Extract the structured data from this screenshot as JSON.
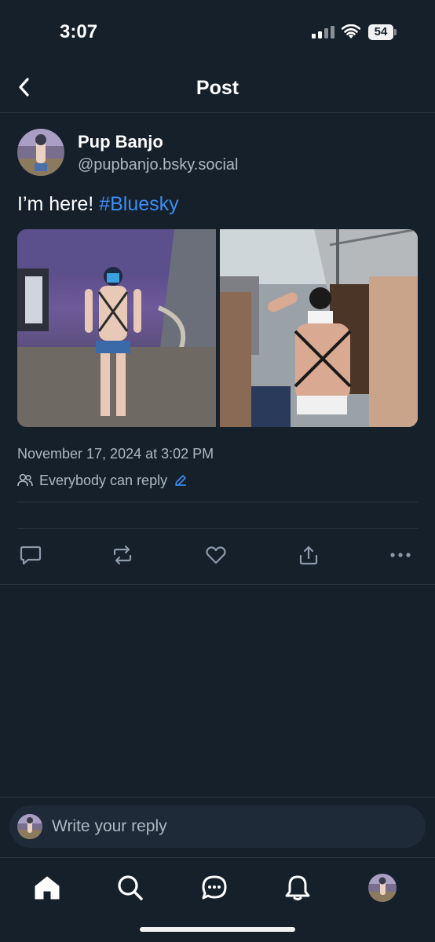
{
  "status_bar": {
    "time": "3:07",
    "battery": "54"
  },
  "header": {
    "title": "Post",
    "back_icon": "chevron-left-icon"
  },
  "post": {
    "author": {
      "name": "Pup Banjo",
      "handle": "@pupbanjo.bsky.social"
    },
    "text": "I’m here! ",
    "hashtag": "#Bluesky",
    "images": [
      "pup-harness-cruise-atrium-photo",
      "pup-salute-cruise-deck-photo"
    ],
    "timestamp": "November 17, 2024 at 3:02 PM",
    "reply_permission": "Everybody can reply",
    "actions": [
      "reply-icon",
      "repost-icon",
      "like-icon",
      "share-icon",
      "more-icon"
    ]
  },
  "reply_bar": {
    "placeholder": "Write your reply"
  },
  "bottom_nav": {
    "items": [
      "home-icon",
      "search-icon",
      "chat-icon",
      "notifications-icon",
      "profile-avatar"
    ]
  },
  "colors": {
    "background": "#16202b",
    "accent": "#3a8ff5",
    "muted_text": "#aeb8c3",
    "divider": "#2a3642"
  }
}
